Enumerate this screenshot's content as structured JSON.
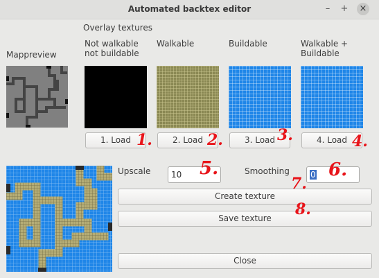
{
  "window": {
    "title": "Automated backtex editor",
    "controls": {
      "minimize": "–",
      "maximize": "+",
      "close": "×"
    }
  },
  "overlay_heading": "Overlay textures",
  "mappreview_label": "Mappreview",
  "textures": [
    {
      "label": "Not walkable\nnot buildable",
      "button": "1. Load",
      "annotation": "1.",
      "color": "#000000"
    },
    {
      "label": "Walkable",
      "button": "2. Load",
      "annotation": "2.",
      "color": "#8a8853"
    },
    {
      "label": "Buildable",
      "button": "3. Load",
      "annotation": "3.",
      "color": "#1f86e8"
    },
    {
      "label": "Walkable +\nBuildable",
      "button": "4. Load",
      "annotation": "4.",
      "color": "#1f86e8"
    }
  ],
  "upscale": {
    "label": "Upscale",
    "value": "10",
    "annotation": "5."
  },
  "smoothing": {
    "label": "Smoothing",
    "value": "0",
    "annotation": "6."
  },
  "create_button": {
    "label": "Create texture",
    "annotation": "7."
  },
  "save_button": {
    "label": "Save texture",
    "annotation": "8."
  },
  "close_button": {
    "label": "Close"
  },
  "colors": {
    "background": "#e9e9e7",
    "annotation_red": "#e8141a",
    "selection": "#3a6fc4",
    "map_gray": "#808080",
    "map_path": "#404040"
  }
}
